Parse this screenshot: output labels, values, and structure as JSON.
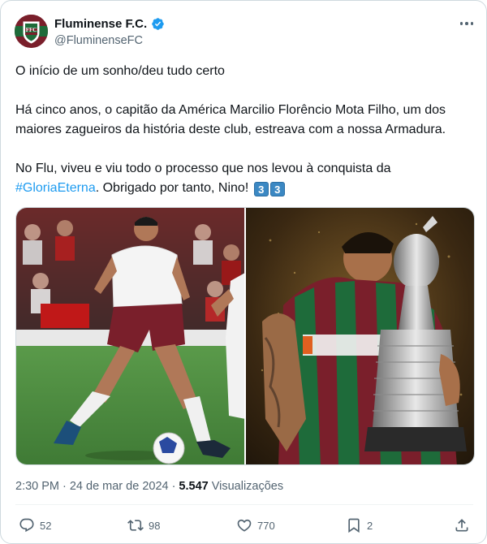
{
  "account": {
    "display_name": "Fluminense F.C.",
    "handle": "@FluminenseFC",
    "verified": true
  },
  "tweet": {
    "line1": "O início de um sonho/deu tudo certo",
    "paragraph2": "Há cinco anos, o capitão da América Marcilio Florêncio Mota Filho, um dos maiores zagueiros da história deste club, estreava com a nossa Armadura.",
    "paragraph3_prefix": "No Flu, viveu e viu todo o processo que nos levou à conquista da",
    "hashtag": "#GloriaEterna",
    "paragraph3_suffix": ". Obrigado por tanto, Nino!",
    "keycap1": "3",
    "keycap2": "3"
  },
  "media": {
    "left_photo": "soccer-player-on-field-photo",
    "right_photo": "player-kissing-trophy-photo"
  },
  "meta": {
    "time": "2:30 PM",
    "separator": "·",
    "date": "24 de mar de 2024",
    "separator2": "·",
    "views_count": "5.547",
    "views_label": "Visualizações"
  },
  "actions": {
    "replies": "52",
    "retweets": "98",
    "likes": "770",
    "bookmarks": "2"
  },
  "colors": {
    "accent": "#1d9bf0",
    "text": "#0f1419",
    "muted": "#536471",
    "border": "#cfd9de"
  }
}
